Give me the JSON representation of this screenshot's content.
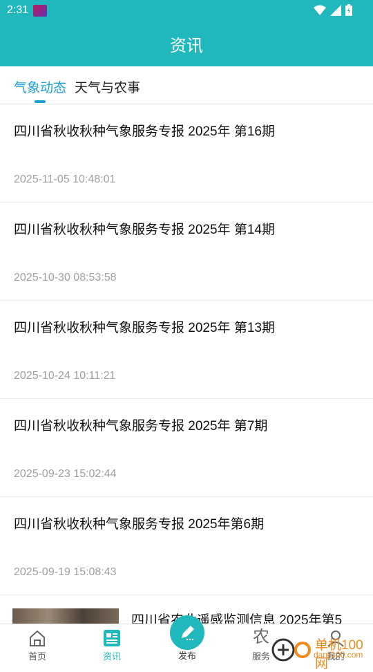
{
  "status_bar": {
    "time": "2:31"
  },
  "header": {
    "title": "资讯"
  },
  "tabs": [
    {
      "label": "气象动态",
      "active": true
    },
    {
      "label": "天气与农事",
      "active": false
    }
  ],
  "news": [
    {
      "title": "四川省秋收秋种气象服务专报 2025年 第16期",
      "date": "2025-11-05 10:48:01"
    },
    {
      "title": "四川省秋收秋种气象服务专报 2025年 第14期",
      "date": "2025-10-30 08:53:58"
    },
    {
      "title": "四川省秋收秋种气象服务专报 2025年 第13期",
      "date": "2025-10-24 10:11:21"
    },
    {
      "title": "四川省秋收秋种气象服务专报 2025年 第7期",
      "date": "2025-09-23 15:02:44"
    },
    {
      "title": "四川省秋收秋种气象服务专报 2025年第6期",
      "date": "2025-09-19 15:08:43"
    }
  ],
  "partial_item": {
    "title": "四川省农业遥感监测信息 2025年第5"
  },
  "bottom_nav": {
    "home": "首页",
    "news": "资讯",
    "publish": "发布",
    "service": "服务",
    "service_icon_text": "农",
    "mine": "我的"
  },
  "watermark": {
    "text": "单机100网",
    "sub": "danji100.com"
  },
  "colors": {
    "primary": "#21b8bd",
    "tab_active": "#1f9fd6",
    "date_gray": "#a0a0a0"
  }
}
